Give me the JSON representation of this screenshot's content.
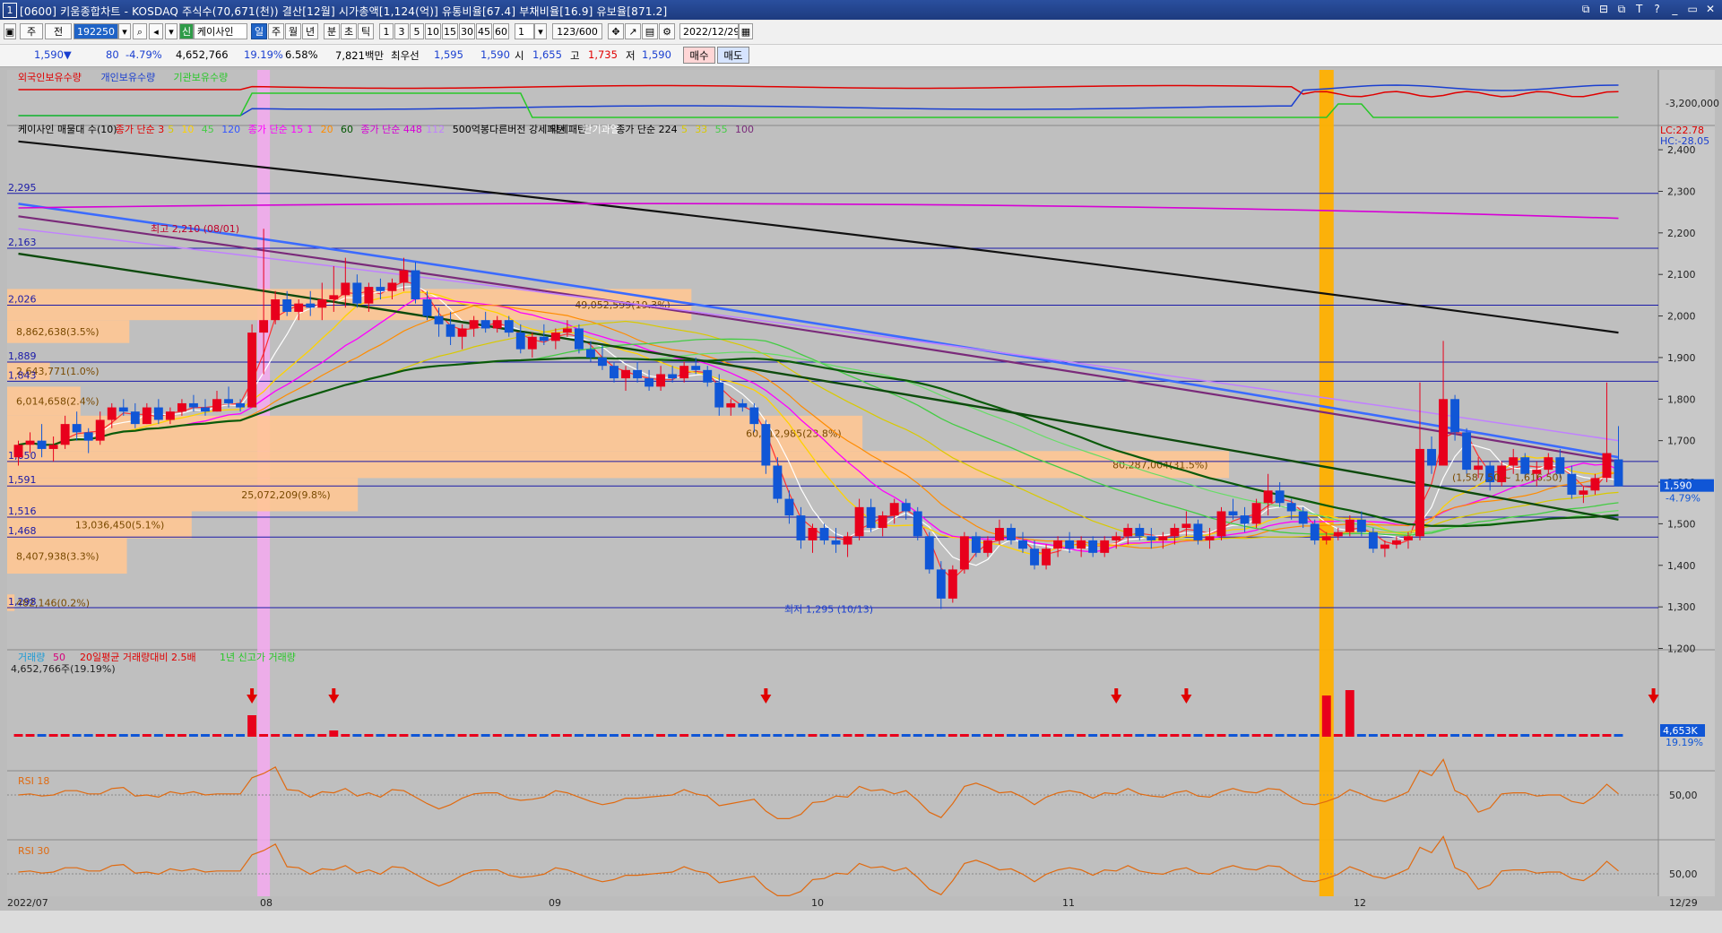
{
  "window": {
    "number": "1",
    "title": "[0600] 키움종합차트 - KOSDAQ 주식수(70,671(천)) 결산[12월] 시가총액[1,124(억)] 유통비율[67.4] 부채비율[16.9] 유보율[871.2]",
    "buttons": [
      "⧉",
      "⊟",
      "⧉",
      "T",
      "?",
      "▭",
      "▭",
      "✕"
    ]
  },
  "toolbar": {
    "period_button": "주",
    "prev_button": "전",
    "code": "192250",
    "stock_name": "케이사인",
    "badge": "신",
    "periods": [
      "일",
      "주",
      "월",
      "년",
      "분",
      "초",
      "틱"
    ],
    "intervals": [
      "1",
      "3",
      "5",
      "10",
      "15",
      "30",
      "45",
      "60"
    ],
    "count_value": "1",
    "range": "123/600",
    "date": "2022/12/29"
  },
  "quote": {
    "price": "1,590▼",
    "change": "80",
    "change_pct": "-4.79%",
    "volume": "4,652,766",
    "vol_ratio": "19.19%",
    "turnover": "6.58%",
    "amount": "7,821백만",
    "best_ask_label": "최우선",
    "best_ask": "1,595",
    "best_bid": "1,590",
    "open_label": "시",
    "open": "1,655",
    "high_label": "고",
    "high": "1,735",
    "low_label": "저",
    "low": "1,590",
    "buy": "매수",
    "sell": "매도"
  },
  "chart_data": {
    "type": "candlestick",
    "x_labels": [
      "2022/07",
      "08",
      "09",
      "10",
      "11",
      "12",
      "12/29"
    ],
    "y_ticks": [
      2400,
      2300,
      2200,
      2100,
      2000,
      1900,
      1800,
      1700,
      1600,
      1500,
      1400,
      1300,
      1200
    ],
    "y_range": [
      1160,
      2480
    ],
    "holders_panel": {
      "legend": [
        "외국인보유수량",
        "개인보유수량",
        "기관보유수량"
      ],
      "axis_label": "-3,200,000",
      "side_labels": [
        "LC:22.78",
        "HC:-28.05"
      ]
    },
    "indicator_legend": [
      {
        "text": "케이사인 매물대 수(10)",
        "color": "#000000"
      },
      {
        "text": "종가 단순 3",
        "color": "#e00000"
      },
      {
        "text": "5",
        "color": "#d9c900"
      },
      {
        "text": "10",
        "color": "#ffd200"
      },
      {
        "text": "45",
        "color": "#44cc44"
      },
      {
        "text": "120",
        "color": "#3355ff"
      },
      {
        "text": "종가 단순 15",
        "color": "#ff00ff"
      },
      {
        "text": "1",
        "color": "#ff00ff"
      },
      {
        "text": "20",
        "color": "#ff8c00"
      },
      {
        "text": "60",
        "color": "#005500"
      },
      {
        "text": "종가 단순 448",
        "color": "#d600d6"
      },
      {
        "text": "112",
        "color": "#c080ff"
      },
      {
        "text": "500억봉다른버전 강세패턴",
        "color": "#000000"
      },
      {
        "text": "약세패턴",
        "color": "#000000"
      },
      {
        "text": "단기과열",
        "color": "#ffffff"
      },
      {
        "text": "종가 단순 224",
        "color": "#000000"
      },
      {
        "text": "5",
        "color": "#d9c900"
      },
      {
        "text": "33",
        "color": "#d9c900"
      },
      {
        "text": "55",
        "color": "#44cc44"
      },
      {
        "text": "100",
        "color": "#7a2a7a"
      }
    ],
    "high_label": "최고 2,210 (08/01)",
    "low_label": "최저 1,295 (10/13)",
    "price_tag": "1,590",
    "price_tag_pct": "-4.79%",
    "hlines": [
      {
        "value": 2295,
        "label": "2,295"
      },
      {
        "value": 2163,
        "label": "2,163"
      },
      {
        "value": 2026,
        "label": "2,026"
      },
      {
        "value": 1889,
        "label": "1,889"
      },
      {
        "value": 1843,
        "label": "1,843"
      },
      {
        "value": 1650,
        "label": "1,650"
      },
      {
        "value": 1591,
        "label": "1,591"
      },
      {
        "value": 1516,
        "label": "1,516"
      },
      {
        "value": 1468,
        "label": "1,468"
      },
      {
        "value": 1298,
        "label": "1,298"
      }
    ],
    "volume_profile": [
      {
        "lo": 1990,
        "hi": 2065,
        "len": 0.56,
        "label": "49,052,599(19.3%)"
      },
      {
        "lo": 1935,
        "hi": 1990,
        "len": 0.1,
        "label": "8,862,638(3.5%)"
      },
      {
        "lo": 1845,
        "hi": 1890,
        "len": 0.035,
        "label": "2,643,771(1.0%)"
      },
      {
        "lo": 1760,
        "hi": 1830,
        "len": 0.06,
        "label": "6,014,658(2.4%)"
      },
      {
        "lo": 1675,
        "hi": 1760,
        "len": 0.7,
        "label": "60,712,985(23.8%)"
      },
      {
        "lo": 1610,
        "hi": 1675,
        "len": 1.0,
        "label": "80,287,004(31.5%)"
      },
      {
        "lo": 1530,
        "hi": 1610,
        "len": 0.287,
        "label": "25,072,209(9.8%)"
      },
      {
        "lo": 1465,
        "hi": 1530,
        "len": 0.151,
        "label": "13,036,450(5.1%)"
      },
      {
        "lo": 1380,
        "hi": 1465,
        "len": 0.098,
        "label": "8,407,938(3.3%)"
      },
      {
        "lo": 1290,
        "hi": 1330,
        "len": 0.006,
        "label": "482,146(0.2%)"
      }
    ],
    "range_annotation": "(1,587.50 ~ 1,616.50)",
    "candles": [
      [
        1660,
        1700,
        1640,
        1690
      ],
      [
        1690,
        1720,
        1670,
        1700
      ],
      [
        1700,
        1740,
        1660,
        1680
      ],
      [
        1680,
        1710,
        1650,
        1690
      ],
      [
        1690,
        1760,
        1680,
        1740
      ],
      [
        1740,
        1770,
        1700,
        1720
      ],
      [
        1720,
        1730,
        1670,
        1700
      ],
      [
        1700,
        1770,
        1690,
        1750
      ],
      [
        1750,
        1790,
        1730,
        1780
      ],
      [
        1780,
        1800,
        1760,
        1770
      ],
      [
        1770,
        1790,
        1730,
        1740
      ],
      [
        1740,
        1790,
        1740,
        1780
      ],
      [
        1780,
        1800,
        1740,
        1750
      ],
      [
        1750,
        1780,
        1740,
        1770
      ],
      [
        1770,
        1800,
        1760,
        1790
      ],
      [
        1790,
        1810,
        1770,
        1780
      ],
      [
        1780,
        1800,
        1760,
        1770
      ],
      [
        1770,
        1820,
        1770,
        1800
      ],
      [
        1800,
        1830,
        1780,
        1790
      ],
      [
        1790,
        1800,
        1770,
        1780
      ],
      [
        1780,
        1980,
        1780,
        1960
      ],
      [
        1960,
        2210,
        1860,
        1990
      ],
      [
        1990,
        2060,
        1980,
        2040
      ],
      [
        2040,
        2060,
        2000,
        2010
      ],
      [
        2010,
        2040,
        1990,
        2030
      ],
      [
        2030,
        2060,
        2000,
        2020
      ],
      [
        2020,
        2080,
        1990,
        2040
      ],
      [
        2040,
        2120,
        2010,
        2050
      ],
      [
        2050,
        2140,
        2020,
        2080
      ],
      [
        2080,
        2100,
        2020,
        2030
      ],
      [
        2030,
        2080,
        2010,
        2070
      ],
      [
        2070,
        2090,
        2040,
        2060
      ],
      [
        2060,
        2090,
        2040,
        2080
      ],
      [
        2080,
        2140,
        2060,
        2110
      ],
      [
        2110,
        2130,
        2030,
        2040
      ],
      [
        2040,
        2060,
        1990,
        2000
      ],
      [
        2000,
        2020,
        1950,
        1980
      ],
      [
        1980,
        2010,
        1930,
        1950
      ],
      [
        1950,
        1980,
        1920,
        1970
      ],
      [
        1970,
        2000,
        1950,
        1990
      ],
      [
        1990,
        2010,
        1960,
        1970
      ],
      [
        1970,
        2000,
        1960,
        1990
      ],
      [
        1990,
        2000,
        1950,
        1960
      ],
      [
        1960,
        1980,
        1910,
        1920
      ],
      [
        1920,
        1960,
        1900,
        1950
      ],
      [
        1950,
        1980,
        1930,
        1940
      ],
      [
        1940,
        1970,
        1920,
        1960
      ],
      [
        1960,
        1990,
        1950,
        1970
      ],
      [
        1970,
        1980,
        1910,
        1920
      ],
      [
        1920,
        1940,
        1890,
        1900
      ],
      [
        1900,
        1930,
        1870,
        1880
      ],
      [
        1880,
        1890,
        1840,
        1850
      ],
      [
        1850,
        1880,
        1820,
        1870
      ],
      [
        1870,
        1890,
        1840,
        1850
      ],
      [
        1850,
        1870,
        1820,
        1830
      ],
      [
        1830,
        1880,
        1820,
        1860
      ],
      [
        1860,
        1880,
        1840,
        1850
      ],
      [
        1850,
        1890,
        1840,
        1880
      ],
      [
        1880,
        1900,
        1860,
        1870
      ],
      [
        1870,
        1880,
        1830,
        1840
      ],
      [
        1840,
        1860,
        1760,
        1780
      ],
      [
        1780,
        1800,
        1760,
        1790
      ],
      [
        1790,
        1800,
        1770,
        1780
      ],
      [
        1780,
        1790,
        1720,
        1740
      ],
      [
        1740,
        1750,
        1620,
        1640
      ],
      [
        1640,
        1660,
        1550,
        1560
      ],
      [
        1560,
        1580,
        1500,
        1520
      ],
      [
        1520,
        1540,
        1440,
        1460
      ],
      [
        1460,
        1500,
        1430,
        1490
      ],
      [
        1490,
        1500,
        1450,
        1460
      ],
      [
        1460,
        1490,
        1430,
        1450
      ],
      [
        1450,
        1480,
        1420,
        1470
      ],
      [
        1470,
        1560,
        1460,
        1540
      ],
      [
        1540,
        1560,
        1480,
        1490
      ],
      [
        1490,
        1530,
        1470,
        1520
      ],
      [
        1520,
        1560,
        1500,
        1550
      ],
      [
        1550,
        1560,
        1510,
        1530
      ],
      [
        1530,
        1540,
        1460,
        1470
      ],
      [
        1470,
        1480,
        1380,
        1390
      ],
      [
        1390,
        1410,
        1295,
        1320
      ],
      [
        1320,
        1400,
        1310,
        1390
      ],
      [
        1390,
        1480,
        1380,
        1470
      ],
      [
        1470,
        1480,
        1420,
        1430
      ],
      [
        1430,
        1470,
        1420,
        1460
      ],
      [
        1460,
        1510,
        1450,
        1490
      ],
      [
        1490,
        1500,
        1450,
        1460
      ],
      [
        1460,
        1480,
        1430,
        1440
      ],
      [
        1440,
        1460,
        1390,
        1400
      ],
      [
        1400,
        1450,
        1390,
        1440
      ],
      [
        1440,
        1470,
        1420,
        1460
      ],
      [
        1460,
        1480,
        1430,
        1440
      ],
      [
        1440,
        1470,
        1420,
        1460
      ],
      [
        1460,
        1470,
        1420,
        1430
      ],
      [
        1430,
        1470,
        1420,
        1460
      ],
      [
        1460,
        1480,
        1440,
        1470
      ],
      [
        1470,
        1500,
        1450,
        1490
      ],
      [
        1490,
        1500,
        1460,
        1470
      ],
      [
        1470,
        1490,
        1440,
        1460
      ],
      [
        1460,
        1480,
        1440,
        1470
      ],
      [
        1470,
        1500,
        1450,
        1490
      ],
      [
        1490,
        1530,
        1470,
        1500
      ],
      [
        1500,
        1510,
        1450,
        1460
      ],
      [
        1460,
        1490,
        1440,
        1470
      ],
      [
        1470,
        1540,
        1460,
        1530
      ],
      [
        1530,
        1560,
        1510,
        1520
      ],
      [
        1520,
        1540,
        1480,
        1500
      ],
      [
        1500,
        1560,
        1490,
        1550
      ],
      [
        1550,
        1620,
        1520,
        1580
      ],
      [
        1580,
        1600,
        1540,
        1550
      ],
      [
        1550,
        1560,
        1510,
        1530
      ],
      [
        1530,
        1540,
        1490,
        1500
      ],
      [
        1500,
        1510,
        1450,
        1460
      ],
      [
        1460,
        1480,
        1450,
        1470
      ],
      [
        1470,
        1490,
        1460,
        1480
      ],
      [
        1480,
        1520,
        1470,
        1510
      ],
      [
        1510,
        1530,
        1470,
        1480
      ],
      [
        1480,
        1490,
        1430,
        1440
      ],
      [
        1440,
        1460,
        1420,
        1450
      ],
      [
        1450,
        1470,
        1440,
        1460
      ],
      [
        1460,
        1480,
        1440,
        1470
      ],
      [
        1470,
        1840,
        1460,
        1680
      ],
      [
        1680,
        1710,
        1620,
        1640
      ],
      [
        1640,
        1940,
        1640,
        1800
      ],
      [
        1800,
        1810,
        1700,
        1720
      ],
      [
        1720,
        1730,
        1620,
        1630
      ],
      [
        1630,
        1660,
        1610,
        1640
      ],
      [
        1640,
        1650,
        1580,
        1600
      ],
      [
        1600,
        1650,
        1590,
        1640
      ],
      [
        1640,
        1680,
        1620,
        1660
      ],
      [
        1660,
        1670,
        1610,
        1620
      ],
      [
        1620,
        1650,
        1590,
        1630
      ],
      [
        1630,
        1670,
        1620,
        1660
      ],
      [
        1660,
        1680,
        1610,
        1620
      ],
      [
        1620,
        1640,
        1560,
        1570
      ],
      [
        1570,
        1590,
        1550,
        1580
      ],
      [
        1580,
        1620,
        1570,
        1610
      ],
      [
        1610,
        1840,
        1600,
        1670
      ],
      [
        1655,
        1735,
        1590,
        1590
      ]
    ],
    "volume_panel": {
      "legend": [
        "거래량",
        "50",
        "20일평균 거래량대비 2.5배",
        "1년 신고가 거래량"
      ],
      "value_label": "4,652,766주(19.19%)",
      "price_tag": "4,653K",
      "price_tag_pct": "19.19%",
      "spike_candles": [
        20,
        22,
        46,
        48,
        82,
        84,
        112,
        114,
        115,
        140
      ]
    },
    "rsi_panels": [
      {
        "label": "RSI 18",
        "axis": "50,00"
      },
      {
        "label": "RSI 30",
        "axis": "50,00"
      }
    ],
    "highlight_columns": [
      "pink",
      "orange"
    ]
  }
}
